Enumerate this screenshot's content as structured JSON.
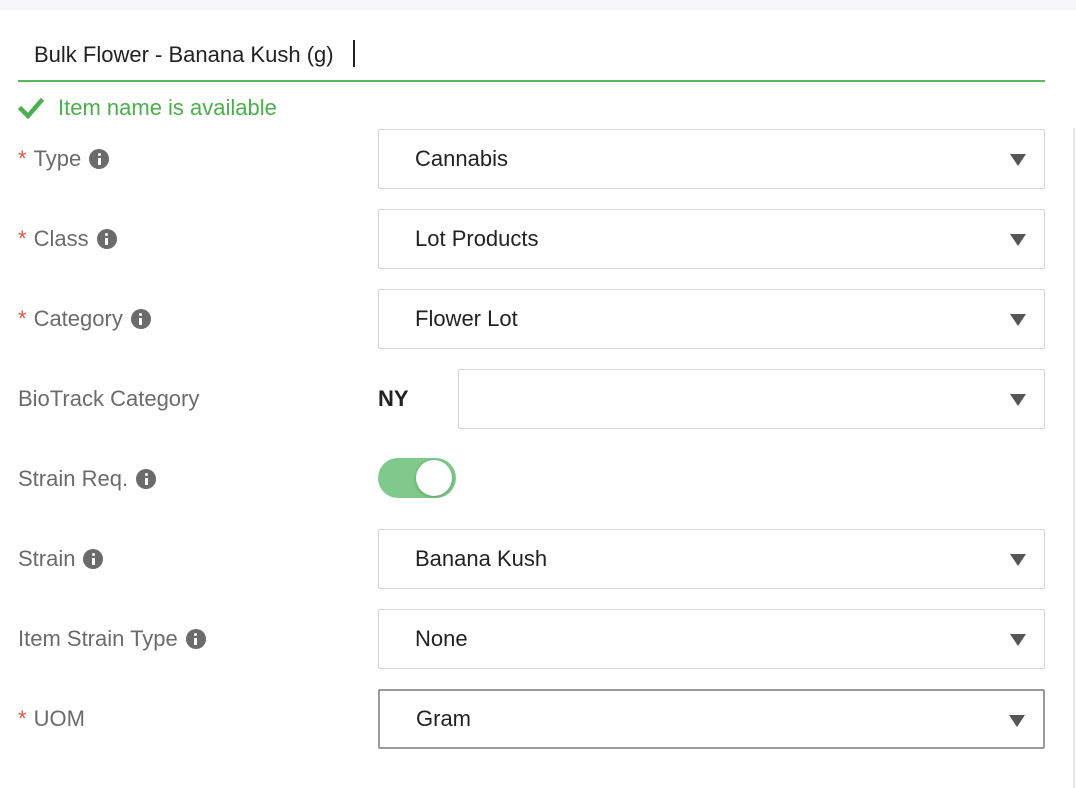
{
  "item_name": {
    "value": "Bulk Flower - Banana Kush (g)",
    "status": "Item name is available"
  },
  "fields": {
    "type": {
      "label": "Type",
      "required": "*",
      "value": "Cannabis"
    },
    "class": {
      "label": "Class",
      "required": "*",
      "value": "Lot Products"
    },
    "category": {
      "label": "Category",
      "required": "*",
      "value": "Flower Lot"
    },
    "biotrack": {
      "label": "BioTrack Category",
      "state": "NY",
      "value": ""
    },
    "strain_req": {
      "label": "Strain Req.",
      "enabled": true
    },
    "strain": {
      "label": "Strain",
      "value": "Banana Kush"
    },
    "item_strain_type": {
      "label": "Item Strain Type",
      "value": "None"
    },
    "uom": {
      "label": "UOM",
      "required": "*",
      "value": "Gram"
    }
  },
  "colors": {
    "success": "#4cae4c",
    "required": "#d9534f",
    "toggle_on": "#7ec98b"
  },
  "icons": {
    "check": "check-icon",
    "info": "info-circle-icon",
    "dropdown": "caret-down-icon"
  }
}
